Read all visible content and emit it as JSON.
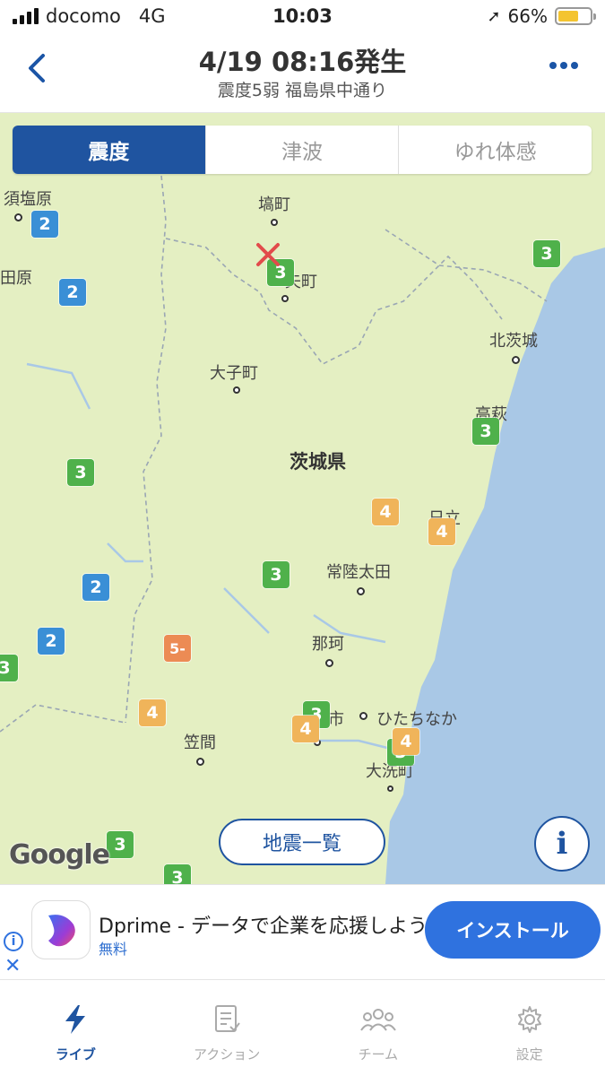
{
  "status_bar": {
    "carrier": "docomo",
    "network": "4G",
    "time": "10:03",
    "battery": "66%"
  },
  "header": {
    "title": "4/19 08:16発生",
    "subtitle": "震度5弱 福島県中通り"
  },
  "segments": [
    {
      "label": "震度",
      "active": true
    },
    {
      "label": "津波",
      "active": false
    },
    {
      "label": "ゆれ体感",
      "active": false
    }
  ],
  "map": {
    "places": {
      "sunaishiobara": "須塩原",
      "hanawa": "塙町",
      "yamizo": "矢町",
      "haraba": "田原",
      "kitaibaraki": "北茨城",
      "daigo": "大子町",
      "takahagi": "高萩",
      "ibaraki_pref": "茨城県",
      "hitachi": "日立",
      "hitachiota": "常陸太田",
      "naka": "那珂",
      "hitachinaka": "ひたちなか",
      "kasama": "笠間",
      "oarai": "大洗町",
      "mito": "市"
    },
    "intensity_badges": [
      {
        "value": "2"
      },
      {
        "value": "2"
      },
      {
        "value": "3"
      },
      {
        "value": "3"
      },
      {
        "value": "3"
      },
      {
        "value": "3"
      },
      {
        "value": "4"
      },
      {
        "value": "4"
      },
      {
        "value": "3"
      },
      {
        "value": "2"
      },
      {
        "value": "2"
      },
      {
        "value": "5-"
      },
      {
        "value": "3"
      },
      {
        "value": "4"
      },
      {
        "value": "3"
      },
      {
        "value": "4"
      },
      {
        "value": "3"
      },
      {
        "value": "4"
      },
      {
        "value": "3"
      },
      {
        "value": "3"
      }
    ],
    "earthquake_list_button": "地震一覧",
    "info_button": "i",
    "google_logo": "Google"
  },
  "ad": {
    "app_name": "Dprime - データで企業を応援しよう",
    "price": "無料",
    "install_label": "インストール"
  },
  "tabs": [
    {
      "label": "ライブ",
      "icon": "lightning-icon",
      "active": true
    },
    {
      "label": "アクション",
      "icon": "checklist-icon",
      "active": false
    },
    {
      "label": "チーム",
      "icon": "team-icon",
      "active": false
    },
    {
      "label": "設定",
      "icon": "gear-icon",
      "active": false
    }
  ],
  "colors": {
    "accent": "#1f54a0",
    "intensity_2": "#3a8fd6",
    "intensity_3": "#4fb14b",
    "intensity_4": "#f0b45a",
    "intensity_5_minus": "#ec8b54",
    "sea": "#a9c8e6",
    "land": "#e4efc2"
  }
}
